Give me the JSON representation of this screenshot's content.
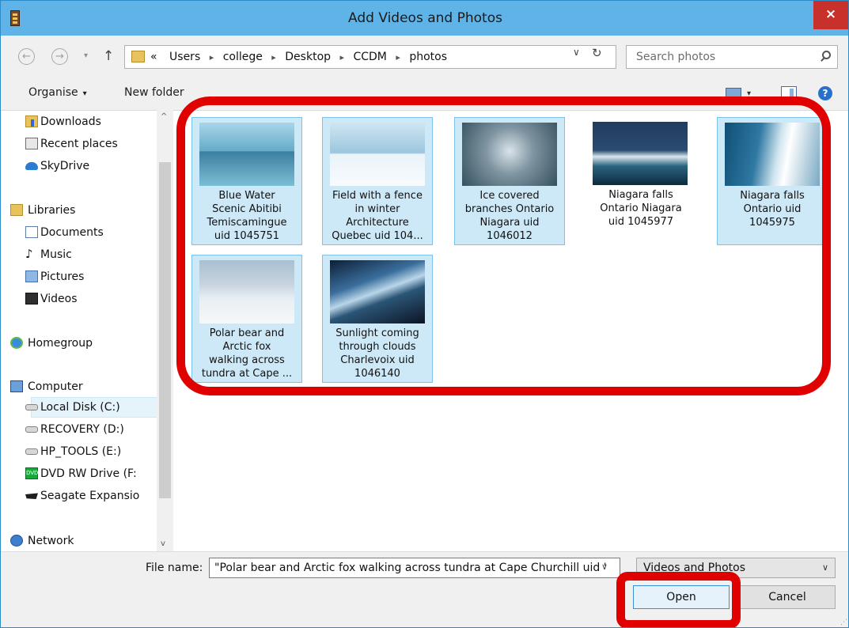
{
  "window": {
    "title": "Add Videos and Photos",
    "close_glyph": "×"
  },
  "nav": {
    "back_glyph": "←",
    "forward_glyph": "→",
    "dropdown_glyph": "▾",
    "up_glyph": "↑",
    "path_prefix": "«",
    "breadcrumb": [
      "Users",
      "college",
      "Desktop",
      "CCDM",
      "photos"
    ],
    "separator": "▸",
    "addr_dropdown_glyph": "∨",
    "refresh_glyph": "↻",
    "search_placeholder": "Search photos"
  },
  "toolbar": {
    "organise": "Organise",
    "organise_caret": "▾",
    "new_folder": "New folder",
    "view_caret": "▾",
    "help_glyph": "?"
  },
  "sidebar": {
    "scroll_up": "^",
    "scroll_down": "v",
    "items": [
      {
        "label": "Downloads",
        "icon": "downloads-icon"
      },
      {
        "label": "Recent places",
        "icon": "recent-places-icon"
      },
      {
        "label": "SkyDrive",
        "icon": "skydrive-icon"
      },
      {
        "label": "Libraries",
        "icon": "libraries-icon"
      },
      {
        "label": "Documents",
        "icon": "documents-icon"
      },
      {
        "label": "Music",
        "icon": "music-icon"
      },
      {
        "label": "Pictures",
        "icon": "pictures-icon"
      },
      {
        "label": "Videos",
        "icon": "videos-icon"
      },
      {
        "label": "Homegroup",
        "icon": "homegroup-icon"
      },
      {
        "label": "Computer",
        "icon": "computer-icon"
      },
      {
        "label": "Local Disk (C:)",
        "icon": "local-disk-icon"
      },
      {
        "label": "RECOVERY (D:)",
        "icon": "drive-icon"
      },
      {
        "label": "HP_TOOLS (E:)",
        "icon": "drive-icon"
      },
      {
        "label": "DVD RW Drive (F:",
        "icon": "dvd-drive-icon"
      },
      {
        "label": "Seagate Expansio",
        "icon": "seagate-drive-icon"
      },
      {
        "label": "Network",
        "icon": "network-icon"
      }
    ],
    "music_glyph": "♪",
    "dvd_glyph": "DVD"
  },
  "files": [
    {
      "lines": [
        "Blue Water",
        "Scenic  Abitibi",
        "Temiscamingue",
        "uid 1045751"
      ],
      "selected": true
    },
    {
      "lines": [
        "Field with a fence",
        "in winter",
        "Architecture",
        "Quebec uid 104..."
      ],
      "selected": true
    },
    {
      "lines": [
        "Ice covered",
        "branches Ontario",
        "Niagara uid",
        "1046012"
      ],
      "selected": true
    },
    {
      "lines": [
        "Niagara falls",
        "Ontario Niagara",
        "uid 1045977"
      ],
      "selected": false
    },
    {
      "lines": [
        "Niagara falls",
        "Ontario uid",
        "1045975"
      ],
      "selected": true
    },
    {
      "lines": [
        "Polar bear and",
        "Arctic fox",
        "walking across",
        "tundra at Cape ..."
      ],
      "selected": true
    },
    {
      "lines": [
        "Sunlight coming",
        "through clouds",
        "Charlevoix uid",
        "1046140"
      ],
      "selected": true
    }
  ],
  "bottom": {
    "file_name_label": "File name:",
    "file_name_value": "\"Polar bear and Arctic fox walking across tundra at Cape Churchill uid '",
    "file_name_dropdown_glyph": "∨",
    "file_type": "Videos and Photos",
    "file_type_caret": "∨",
    "open": "Open",
    "cancel": "Cancel",
    "grip_glyph": "⋰"
  },
  "colors": {
    "accent": "#5fb3e6",
    "annotation": "#e00000",
    "selection": "#cde8f7"
  }
}
